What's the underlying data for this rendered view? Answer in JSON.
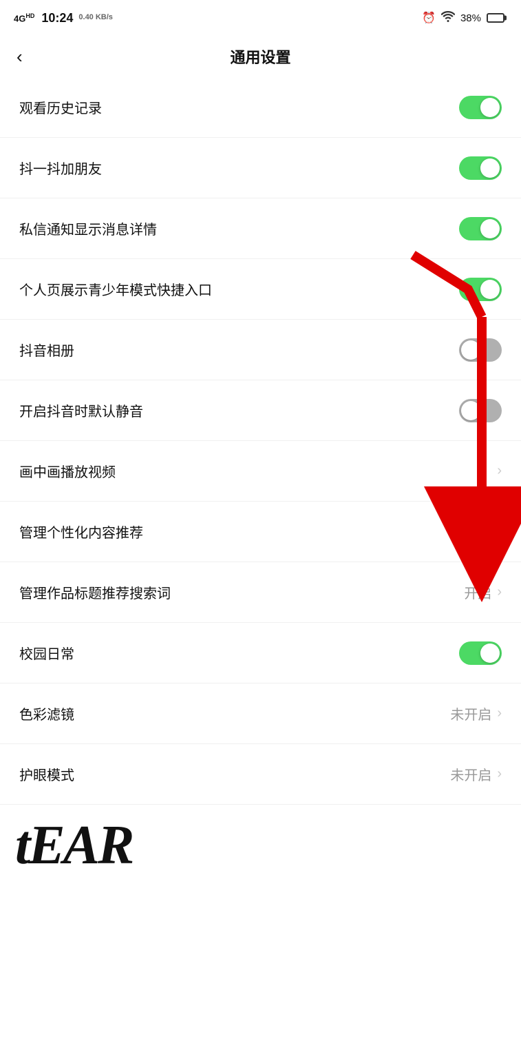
{
  "statusBar": {
    "network": "4GHD",
    "time": "10:24",
    "speed": "0.40 KB/s",
    "battery": "38%"
  },
  "header": {
    "backLabel": "‹",
    "title": "通用设置"
  },
  "settings": [
    {
      "id": "watch-history",
      "label": "观看历史记录",
      "type": "toggle",
      "state": "on",
      "value": "",
      "showChevron": false
    },
    {
      "id": "shake-add-friend",
      "label": "抖一抖加朋友",
      "type": "toggle",
      "state": "on",
      "value": "",
      "showChevron": false
    },
    {
      "id": "dm-notification-detail",
      "label": "私信通知显示消息详情",
      "type": "toggle",
      "state": "on",
      "value": "",
      "showChevron": false
    },
    {
      "id": "youth-mode-shortcut",
      "label": "个人页展示青少年模式快捷入口",
      "type": "toggle",
      "state": "on",
      "value": "",
      "showChevron": false,
      "hasRedArrow": true
    },
    {
      "id": "douyin-album",
      "label": "抖音相册",
      "type": "toggle",
      "state": "off",
      "value": "",
      "showChevron": false
    },
    {
      "id": "default-mute",
      "label": "开启抖音时默认静音",
      "type": "toggle",
      "state": "off",
      "value": "",
      "showChevron": false
    },
    {
      "id": "picture-in-picture",
      "label": "画中画播放视频",
      "type": "chevron",
      "state": "",
      "value": "",
      "showChevron": true
    },
    {
      "id": "manage-personalized",
      "label": "管理个性化内容推荐",
      "type": "chevron",
      "state": "",
      "value": "",
      "showChevron": true
    },
    {
      "id": "title-search-recommend",
      "label": "管理作品标题推荐搜索词",
      "type": "value-chevron",
      "state": "",
      "value": "开启",
      "showChevron": true
    },
    {
      "id": "campus-daily",
      "label": "校园日常",
      "type": "toggle",
      "state": "on",
      "value": "",
      "showChevron": false
    },
    {
      "id": "color-filter",
      "label": "色彩滤镜",
      "type": "value-chevron",
      "state": "",
      "value": "未开启",
      "showChevron": true
    },
    {
      "id": "eye-protection",
      "label": "护眼模式",
      "type": "value-chevron",
      "state": "",
      "value": "未开启",
      "showChevron": true
    }
  ],
  "tearText": "tEAR"
}
